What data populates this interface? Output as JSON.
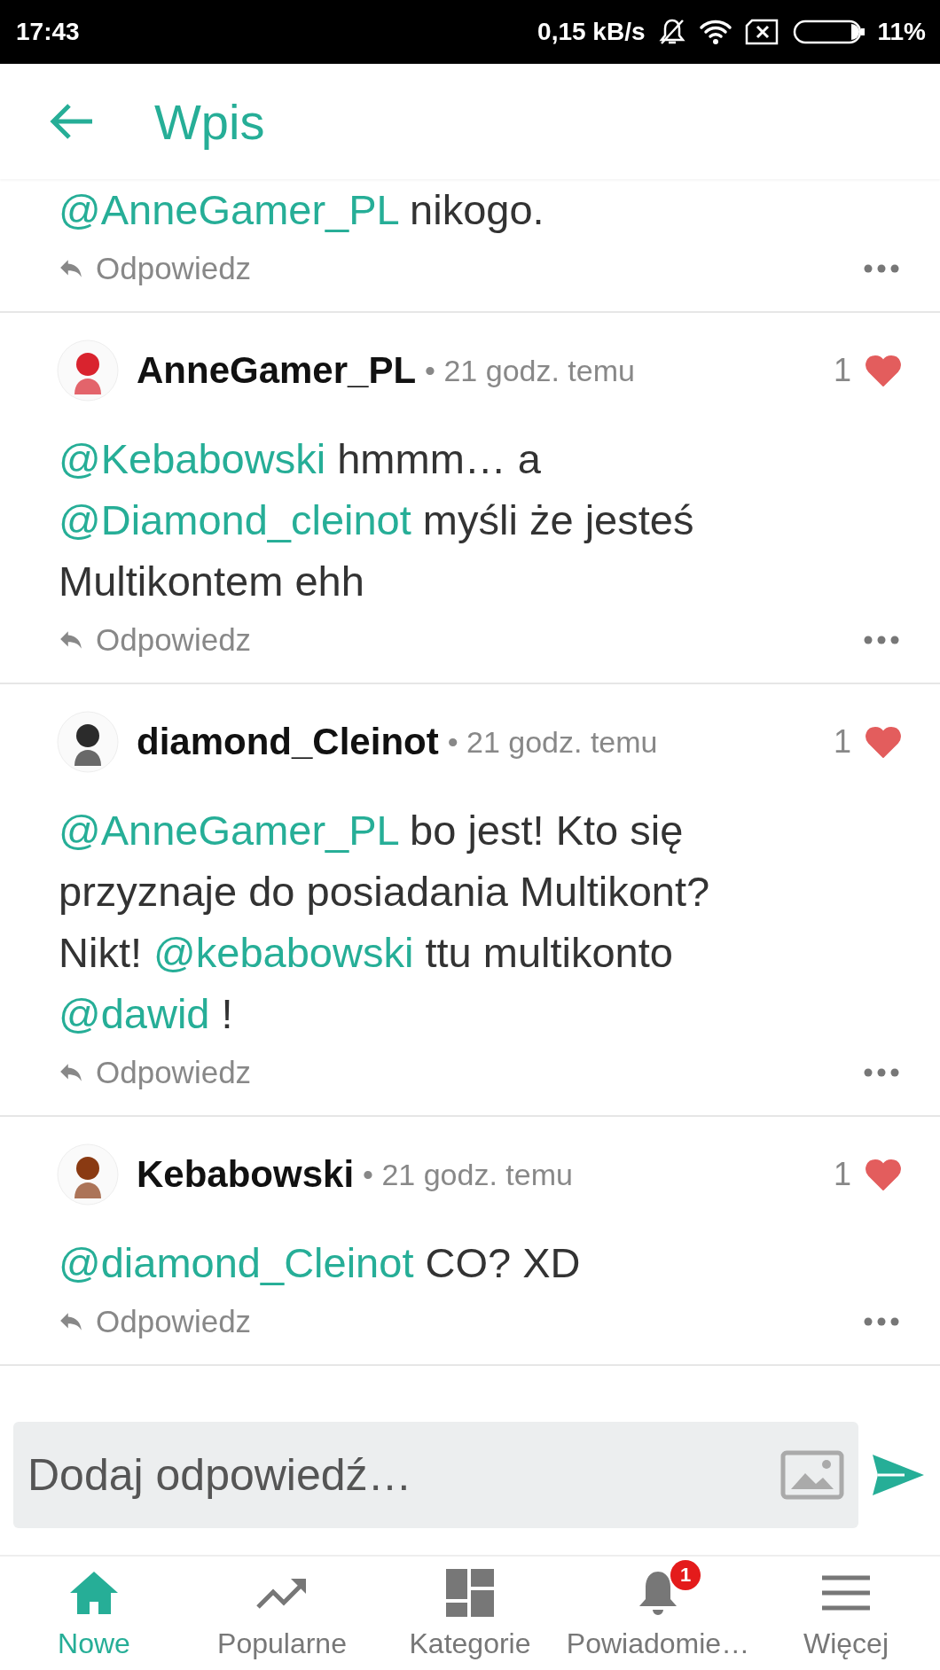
{
  "status_bar": {
    "time": "17:43",
    "speed": "0,15 kB/s",
    "battery": "11%"
  },
  "header": {
    "title": "Wpis"
  },
  "partial_comment": {
    "body": [
      {
        "kind": "mention",
        "text": "@AnneGamer_PL"
      },
      {
        "kind": "text",
        "text": " nikogo."
      }
    ],
    "reply": "Odpowiedz"
  },
  "comments": [
    {
      "author": "AnneGamer_PL",
      "time": "• 21 godz. temu",
      "likes": "1",
      "liked": true,
      "body": [
        {
          "kind": "mention",
          "text": "@Kebabowski"
        },
        {
          "kind": "text",
          "text": " hmmm… a "
        },
        {
          "kind": "mention",
          "text": "@Diamond_cleinot"
        },
        {
          "kind": "text",
          "text": " myśli że jesteś Multikontem ehh"
        }
      ],
      "reply": "Odpowiedz"
    },
    {
      "author": "diamond_Cleinot",
      "time": "• 21 godz. temu",
      "likes": "1",
      "liked": true,
      "body": [
        {
          "kind": "mention",
          "text": "@AnneGamer_PL"
        },
        {
          "kind": "text",
          "text": " bo jest! Kto się przyznaje do posiadania Multikont? Nikt! "
        },
        {
          "kind": "mention",
          "text": "@kebabowski"
        },
        {
          "kind": "text",
          "text": " ttu multikonto "
        },
        {
          "kind": "mention",
          "text": "@dawid"
        },
        {
          "kind": "text",
          "text": " !"
        }
      ],
      "reply": "Odpowiedz"
    },
    {
      "author": "Kebabowski",
      "time": "• 21 godz. temu",
      "likes": "1",
      "liked": true,
      "body": [
        {
          "kind": "mention",
          "text": "@diamond_Cleinot"
        },
        {
          "kind": "text",
          "text": " CO? XD"
        }
      ],
      "reply": "Odpowiedz"
    }
  ],
  "composer": {
    "placeholder": "Dodaj odpowiedź…"
  },
  "nav": [
    {
      "label": "Nowe",
      "selected": true
    },
    {
      "label": "Popularne",
      "selected": false
    },
    {
      "label": "Kategorie",
      "selected": false
    },
    {
      "label": "Powiadomie…",
      "selected": false,
      "badge": "1"
    },
    {
      "label": "Więcej",
      "selected": false
    }
  ]
}
